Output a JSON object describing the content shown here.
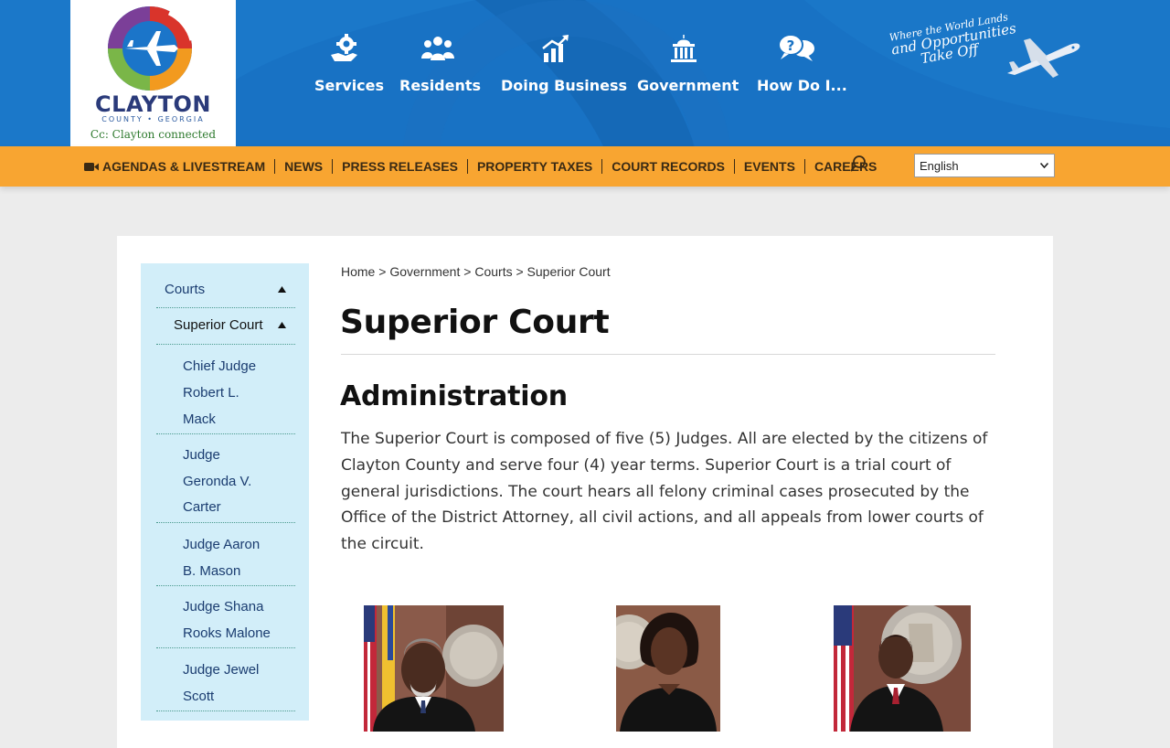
{
  "logo": {
    "word": "CLAYTON",
    "sub": "COUNTY • GEORGIA",
    "tagline": "Cc: Clayton connected"
  },
  "main_nav": [
    {
      "label": "Services",
      "icon": "hand-gear-icon"
    },
    {
      "label": "Residents",
      "icon": "people-group-icon"
    },
    {
      "label": "Doing Business",
      "icon": "growth-chart-icon"
    },
    {
      "label": "Government",
      "icon": "capitol-building-icon"
    },
    {
      "label": "How Do I...",
      "icon": "question-bubbles-icon"
    }
  ],
  "slogan": {
    "line1": "Where the World Lands",
    "line2": "and Opportunities",
    "line3": "Take Off"
  },
  "utility_links": [
    "AGENDAS & LIVESTREAM",
    "NEWS",
    "PRESS RELEASES",
    "PROPERTY TAXES",
    "COURT RECORDS",
    "EVENTS",
    "CAREERS"
  ],
  "language": {
    "selected": "English"
  },
  "sidenav": {
    "courts": "Courts",
    "superior_court": "Superior Court",
    "items": [
      [
        "Chief Judge",
        "Robert L.",
        "Mack"
      ],
      [
        "Judge",
        "Geronda V.",
        "Carter"
      ],
      [
        "Judge Aaron",
        "B. Mason"
      ],
      [
        "Judge Shana",
        "Rooks Malone"
      ],
      [
        "Judge Jewel",
        "Scott"
      ]
    ]
  },
  "breadcrumb": {
    "home": "Home",
    "government": "Government",
    "courts": "Courts",
    "current": "Superior Court",
    "sep": ">"
  },
  "page": {
    "title": "Superior Court",
    "section_title": "Administration",
    "body_lines": [
      "The Superior Court is composed of five (5) Judges. All are elected by the citizens of",
      "Clayton County and serve four (4) year terms. Superior Court is a trial court of",
      "general jurisdictions. The court hears all felony criminal cases prosecuted by the",
      "Office of the District Attorney, all civil actions, and all appeals from lower courts of",
      "the circuit."
    ]
  },
  "colors": {
    "header_blue": "#1872c4",
    "utility_orange": "#f8a531",
    "sidenav_bg": "#d2eef9",
    "link_navy": "#1a3c70"
  }
}
